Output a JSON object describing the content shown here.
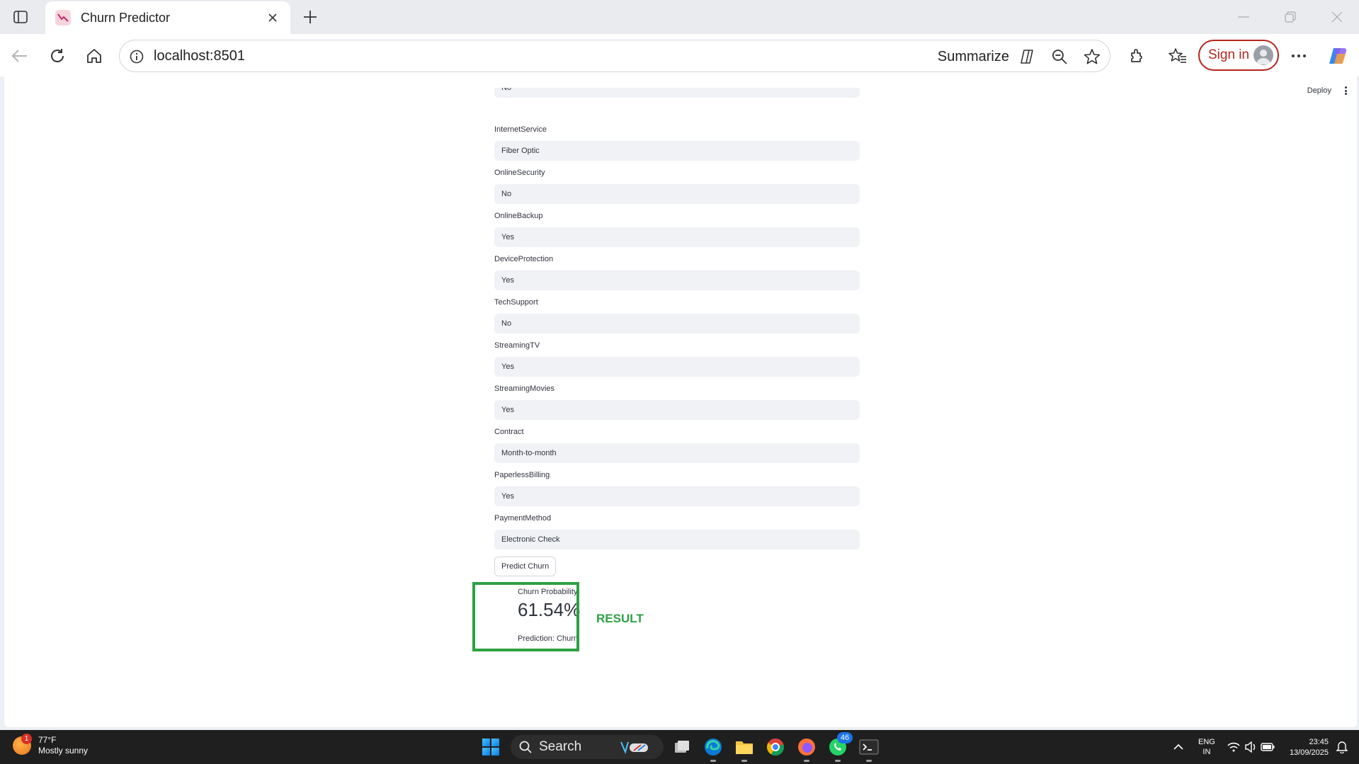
{
  "browser": {
    "tab_title": "Churn Predictor",
    "url": "localhost:8501",
    "summarize_label": "Summarize",
    "signin_label": "Sign in"
  },
  "app": {
    "deploy_label": "Deploy",
    "partial_field_value": "No",
    "fields": [
      {
        "label": "InternetService",
        "value": "Fiber Optic"
      },
      {
        "label": "OnlineSecurity",
        "value": "No"
      },
      {
        "label": "OnlineBackup",
        "value": "Yes"
      },
      {
        "label": "DeviceProtection",
        "value": "Yes"
      },
      {
        "label": "TechSupport",
        "value": "No"
      },
      {
        "label": "StreamingTV",
        "value": "Yes"
      },
      {
        "label": "StreamingMovies",
        "value": "Yes"
      },
      {
        "label": "Contract",
        "value": "Month-to-month"
      },
      {
        "label": "PaperlessBilling",
        "value": "Yes"
      },
      {
        "label": "PaymentMethod",
        "value": "Electronic Check"
      }
    ],
    "predict_button": "Predict Churn",
    "metric_label": "Churn Probability",
    "metric_value": "61.54%",
    "prediction_text": "Prediction: Churn",
    "result_tag": "RESULT",
    "result_color": "#2ea043"
  },
  "taskbar": {
    "weather_temp": "77°F",
    "weather_condition": "Mostly sunny",
    "weather_badge": "1",
    "search_label": "Search",
    "whatsapp_badge": "46",
    "lang_line1": "ENG",
    "lang_line2": "IN",
    "time": "23:45",
    "date": "13/09/2025"
  }
}
